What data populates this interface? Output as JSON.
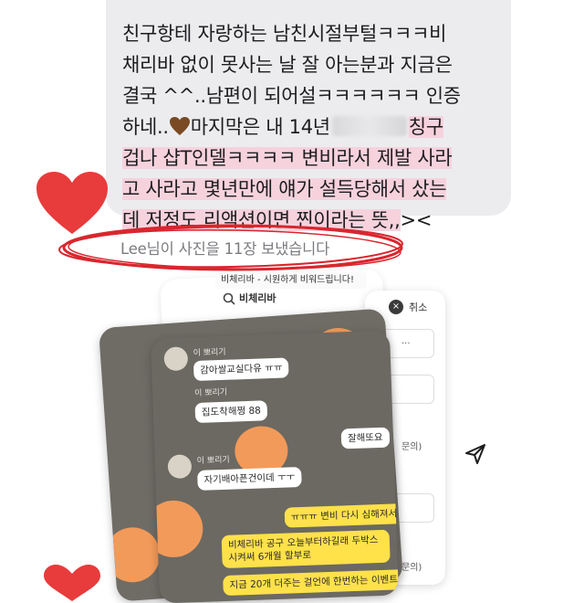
{
  "message": {
    "lines": [
      {
        "text": "친구항테 자랑하는 남친시절부털ㅋㅋㅋ비",
        "highlight": false
      },
      {
        "text": "채리바 없이 못사는 날 잘 아는분과 지금은",
        "highlight": false
      },
      {
        "text": "결국 ^^..남편이 되어설ㅋㅋㅋㅋㅋㅋ 인증",
        "highlight": false
      },
      {
        "pre": "하네..",
        "mid": "마지막은 내 14년",
        "post": "칭구",
        "highlight": "partial"
      },
      {
        "text": "겁나 샵T인델ㅋㅋㅋㅋ 변비라서 제발 사라",
        "highlight": true
      },
      {
        "text": "고 사라고 몇년만에 얘가 설득당해서 샀는",
        "highlight": true
      },
      {
        "text": "데 저정도 리액션이면 찐이라는 뜻,,",
        "tail": "><",
        "highlight": true
      }
    ]
  },
  "system_notice": "Lee님이 사진을 11장 보냈습니다",
  "collage": {
    "top_strip": "비체리바 - 시원하게 비워드립니다!",
    "brand": "비체리바",
    "cancel": "취소",
    "close_glyph": "×",
    "chat1": {
      "name1": "이 뽀리기",
      "bubble1": "감아쌀교실다유 ㅠㅠ",
      "name2": "이 뽀리기",
      "bubble2": "집도착해쩡 88",
      "name3": "이 뽀리기",
      "bubble3": "자기배아픈건이데 ㅜㅜ",
      "yellow1": "ㅠㅠㅠ 변비 다시 심해져서",
      "yellow2": "비체리바 공구 오늘부터하길래 두박스 시켜써 6개월 할부로",
      "yellow3": "지금 20개 더주는 걸언에 한번하는 이벤트해서",
      "white_right": "잘해또요"
    },
    "right_panel": {
      "items": [
        "문의)",
        "문의)",
        "문의)"
      ],
      "more": "..."
    }
  },
  "colors": {
    "bubble": "#ececef",
    "highlight": "#f6d2dd",
    "heart": "#e83b3b",
    "scribble": "#d9262e",
    "chat_bg": "#6f6c65",
    "yellow_bubble": "#ffe14a"
  },
  "icons": [
    "heart-icon",
    "brown-heart-emoji",
    "send-icon",
    "close-icon",
    "search-icon"
  ]
}
